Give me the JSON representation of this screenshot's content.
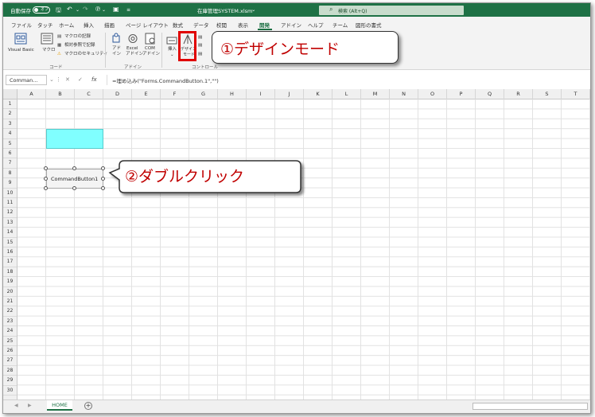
{
  "titlebar": {
    "autosave_label": "自動保存",
    "autosave_state": "オフ",
    "filename": "在庫管理SYSTEM.xlsm",
    "search_placeholder": "検索 (Alt+Q)"
  },
  "tabs": [
    "ファイル",
    "タッチ",
    "ホーム",
    "挿入",
    "描画",
    "ページ レイアウト",
    "数式",
    "データ",
    "校閲",
    "表示",
    "開発",
    "アドイン",
    "ヘルプ",
    "チーム",
    "図形の書式"
  ],
  "active_tab": "開発",
  "ribbon": {
    "code": {
      "visual_basic": "Visual Basic",
      "macro": "マクロ",
      "record_macro": "マクロの記録",
      "relative_ref": "相対参照で記録",
      "macro_security": "マクロのセキュリティ",
      "group_label": "コード"
    },
    "addins": {
      "ad": "アド\nイン",
      "ad_line1": "アド",
      "ad_line2": "イン",
      "excel_line1": "Excel",
      "excel_line2": "アドイン",
      "com_line1": "COM",
      "com_line2": "アドイン",
      "group_label": "アドイン"
    },
    "controls": {
      "insert": "挿入",
      "design_line1": "デザイン",
      "design_line2": "モード",
      "group_label": "コントロール"
    }
  },
  "callouts": {
    "design_mode": "①デザインモード",
    "double_click": "②ダブルクリック"
  },
  "formula_bar": {
    "name_box": "Comman...",
    "formula": "=埋め込み(\"Forms.CommandButton.1\",\"\")"
  },
  "columns": [
    "A",
    "B",
    "C",
    "D",
    "E",
    "F",
    "G",
    "H",
    "I",
    "J",
    "K",
    "L",
    "M",
    "N",
    "O",
    "P",
    "Q",
    "R",
    "S",
    "T"
  ],
  "rows": [
    "1",
    "2",
    "3",
    "4",
    "5",
    "6",
    "7",
    "8",
    "9",
    "10",
    "11",
    "12",
    "13",
    "14",
    "15",
    "16",
    "17",
    "18",
    "19",
    "20",
    "21",
    "22",
    "23",
    "24",
    "25",
    "26",
    "27",
    "28",
    "29",
    "30"
  ],
  "command_button_label": "CommandButton1",
  "sheet_tab": "HOME",
  "colors": {
    "brand_green": "#1e7145",
    "cyan_fill": "#80ffff",
    "highlight_red": "#e00000",
    "callout_text": "#c00000"
  }
}
